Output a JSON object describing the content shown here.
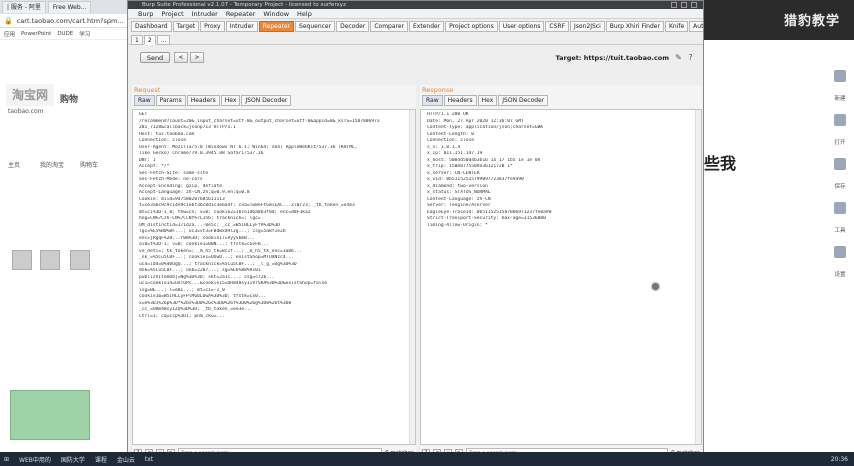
{
  "bg_browser": {
    "tabs": [
      "| 服务 - 阿里",
      "Free Web..."
    ],
    "url": "cart.taobao.com/cart.htm?spm...",
    "bookmarks": [
      "应用",
      "PowerPoint",
      "DUDE",
      "学习"
    ],
    "logo_text": "淘宝网",
    "side_texts": [
      "购物",
      "taobao.com",
      "主页",
      "我的淘宝",
      "购物车"
    ]
  },
  "burp": {
    "title": "Burp Suite Professional v2.1.07 - Temporary Project - licensed to surferxyz",
    "menu": [
      "Burp",
      "Project",
      "Intruder",
      "Repeater",
      "Window",
      "Help"
    ],
    "tabs": [
      "Dashboard",
      "Target",
      "Proxy",
      "Intruder",
      "Repeater",
      "Sequencer",
      "Decoder",
      "Comparer",
      "Extender",
      "Project options",
      "User options",
      "CSRF",
      "Json2JSci",
      "Burp Xhiri Finder",
      "Knife",
      "Authz"
    ],
    "subtabs": [
      "1",
      "2",
      "..."
    ],
    "send_label": "Send",
    "target_label": "Target: https://tuit.taobao.com",
    "request": {
      "title": "Request",
      "tabs": [
        "Raw",
        "Params",
        "Headers",
        "Hex",
        "JSON Decoder"
      ],
      "lines": [
        "GET",
        "/recommend?count=20&_input_charset=utf-8&_output_charset=utf-8&appid=8&_ksTS=1587806973",
        "281_7128&callback=jsonp713 HTTP/1.1",
        "Host: tui.taobao.com",
        "Connection: close",
        "User-Agent: Mozilla/5.0 (Windows NT 6.1; Win64; x64) AppleWebKit/537.36 (KHTML,",
        "like Gecko) Chrome/79.0.3945.88 Safari/537.36",
        "DNT: 1",
        "Accept: */*",
        "Sec-Fetch-Site: same-site",
        "Sec-Fetch-Mode: no-cors",
        "Accept-Encoding: gzip, deflate",
        "Accept-Language: zh-CN,zh;q=0.9,en;q=0.8",
        "Cookie: miid=947580207685611113",
        "t=ce3a6c9c9c14e9c1ebf3bc0d1c3e6a4f; cna=Tw8eFtGmiEAC...Zl0r23; _tb_token_=e4b3",
        "mt=ci%3D-1_0; thw=cn; v=0; cookie2=1bce1d6a8b3f0d; enc=d8F3ka2",
        "hng=CN%7Czh-CN%7CCNY%7C156; tracknick=; lgc=",
        "UM_distinctid=171d2a...-0e5c; _cc_=W5iHLLyFfA%3D%3D",
        "lgc=%E5%B0%8F...; uc3=vt3=F8dBxd9lJg...; csg=5a8f1e2b",
        "enc=jRgqF%2B...r0m%3D; cookie17=VyySbmB...",
        "ai8=t%3D-1; v=0; cookie1=B0N...; tfstk=cGvFB...",
        "ve_deti=; tk_token=; _m_h5_tk=8c1f...; _m_h5_tk_enc=3a0b...",
        "_nk_=%5Cu5C0F...; cookie1=UUwU...; existShop=MTU4Nzc4...",
        "uc4=id4=0%40UgQ...; tracknick=%5Cu5C0F...; _l_g_=Ug%3D%3D",
        "dnk=%5Cu5C0F...; unb=2207...; sg=%E6%88%9101",
        "publishItemObj=Ng%3D%3D; skt=2a1c...; csg=c72b...",
        "uc1=cookie14=UoTUPc...&cookie15=URm48syIIVrSKA%3D%3D&existShop=false",
        "isg=BE...; l=eBI...; mt=ci=-1_0",
        "cookie16=W5iHLLyFPlMGbLDwA%3D%3D; tfstk=cx0...",
        "x=e%3D1%26p%3D*%26s%3D0%26c%3D0%26f%3D0%26g%3D0%26t%3D0",
        "_cc_=URm48syIZQ%3D%3D; _tb_token_=ee3e...",
        "Ctrl=1; cq=ccp%3D1; pnm_cku=..."
      ]
    },
    "response": {
      "title": "Response",
      "tabs": [
        "Raw",
        "Headers",
        "Hex",
        "JSON Decoder"
      ],
      "lines": [
        "HTTP/1.1 200 OK",
        "Date: Mon, 27 Apr 2020 12:36:07 GMT",
        "Content-Type: application/json;charset=GBK",
        "Content-Length: 0",
        "Connection: close",
        "s_v: 1.0.1.4",
        "x_ip: 011.151.147.19",
        "x_host: 5084d50d4b3b16 1a 17 1b5 1e 1e 0h",
        "x_trip: 150b0775509a3612172B 1*",
        "x_server: CN-CENTER",
        "x_vid: 0b51152515799097723837fe9a90",
        "x_diamond: two-version",
        "x_status: STATUS_NORMAL",
        "Content-Language: zh-CN",
        "Server: Tengine/Aserver",
        "EagleEye-TraceId: 0b5115251587806971237fe0a90",
        "Strict-Transport-Security: max-age=31536000",
        "Timing-Allow-Origin: *"
      ]
    },
    "search_placeholder": "Type a search term",
    "matches_label": "0 matches"
  },
  "bg_right": {
    "watermark": "猎豹教学",
    "side_labels": [
      "新建",
      "打开",
      "保存",
      "工具",
      "设置"
    ],
    "big_text": "些我"
  },
  "taskbar": {
    "items": [
      "WEB中用的",
      "国防大学",
      "课程",
      "金山云",
      "txt"
    ],
    "clock": "20:36"
  }
}
